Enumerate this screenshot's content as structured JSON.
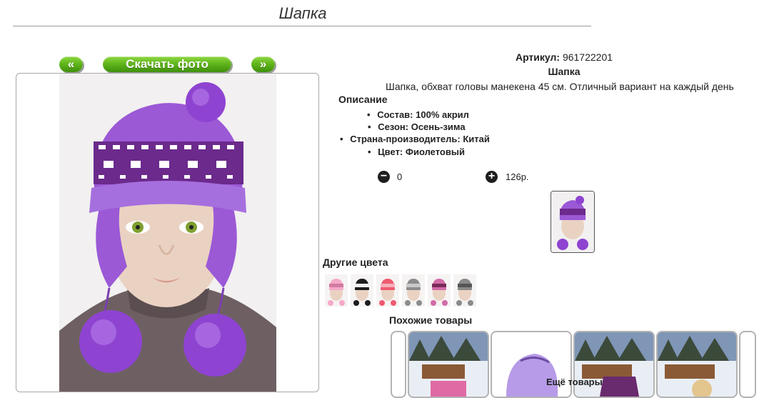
{
  "page": {
    "title": "Шапка"
  },
  "gallery": {
    "prev_label": "«",
    "download_label": "Скачать фото",
    "next_label": "»"
  },
  "product": {
    "article_label": "Артикул:",
    "article_value": "961722201",
    "name": "Шапка",
    "description": "Шапка, обхват головы манекена 45 см. Отличный вариант на каждый день",
    "description_heading": "Описание",
    "properties": [
      {
        "label": "Состав:",
        "value": "100% акрил"
      },
      {
        "label": "Сезон:",
        "value": "Осень-зима"
      },
      {
        "label": "Страна-производитель:",
        "value": "Китай"
      },
      {
        "label": "Цвет:",
        "value": "Фиолетовый"
      }
    ]
  },
  "cart": {
    "quantity": "0",
    "price": "126р."
  },
  "other_colors": {
    "heading": "Другие цвета",
    "swatches": [
      "#f4a9c8",
      "#1c1c1c",
      "#ef5a6f",
      "#8c8c8c",
      "#d26ba8",
      "#8a8a8a"
    ]
  },
  "similar": {
    "heading": "Похожие товары",
    "more_label": "Ещё товары"
  },
  "colors": {
    "accent_green": "#62b71c",
    "hat_purple": "#9b59d6",
    "dark_purple": "#6b2a8c"
  }
}
